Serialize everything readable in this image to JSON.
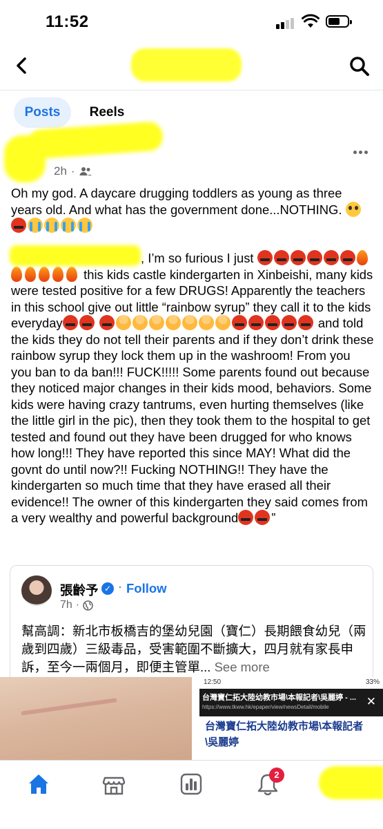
{
  "status_bar": {
    "time": "11:52"
  },
  "tabs": [
    {
      "label": "Posts"
    },
    {
      "label": "Reels"
    }
  ],
  "post": {
    "time": "2h",
    "paragraph1_text": "Oh my god. A daycare drugging toddlers as young as three years old. And what has the government done...NOTHING.",
    "p2_intro": ", I’m so furious I just",
    "p2_after_emojis": "this kids castle kindergarten in Xinbeishi, many kids were tested positive for a few DRUGS! Apparently the teachers in this school give out little “rainbow syrup” they call it to the kids everyday",
    "p2_mid": "and told the kids they do not tell their parents and if they don’t drink these rainbow syrup they lock them up in the washroom! From you you ban to da ban!!! FUCK!!!!! Some parents found out because they noticed major changes in their kids mood, behaviors. Some kids were having crazy tantrums, even hurting themselves (like the little girl in the pic), then they took them to the hospital to get tested and found out they have been drugged for who knows how long!!! They have reported this since MAY! What did the govnt do until now?!! Fucking NOTHING!! They have the kindergarten so much time that they have erased all their evidence!! The owner of this kindergarten they said comes from a very wealthy and powerful background",
    "p2_end": "”"
  },
  "shared_post": {
    "author": "張齡予",
    "follow_label": "Follow",
    "time": "7h",
    "text": "幫高調：新北市板橋吉的堡幼兒園（寶仁）長期餵食幼兒（兩歲到四歲）三級毒品，受害範圍不斷擴大，四月就有家長申訴，至今一兩個月，即便主管單...",
    "see_more": "See more"
  },
  "media_preview": {
    "status_time": "12:50",
    "status_battery": "33%",
    "page_title": "台灣寶仁拓大陸幼教市場\\本報記者\\吳麗婷 - ...",
    "page_url": "https://www.tkww.hk/epaper/view/newsDetail/mobile",
    "headline": "台灣寶仁拓大陸幼教市場\\本報記者\\吳麗婷"
  },
  "bottom_nav": {
    "notification_count": "2"
  },
  "colors": {
    "accent": "#1b74e4",
    "highlight": "#ffff22",
    "badge": "#e41e3f"
  }
}
